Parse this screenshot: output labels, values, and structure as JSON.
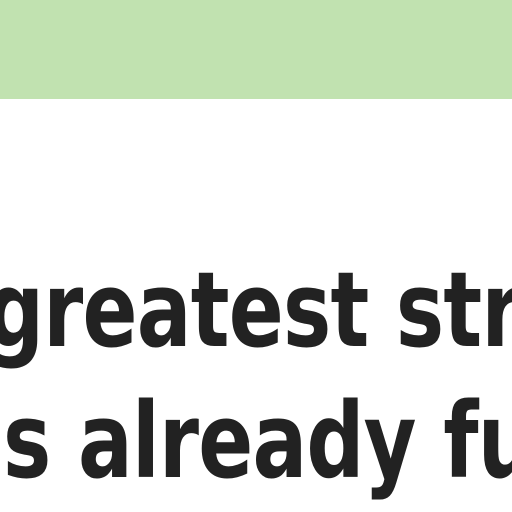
{
  "banner": {
    "color": "#c1e2b0"
  },
  "headline": {
    "line1": "greatest stre",
    "line2": "is already fu"
  }
}
